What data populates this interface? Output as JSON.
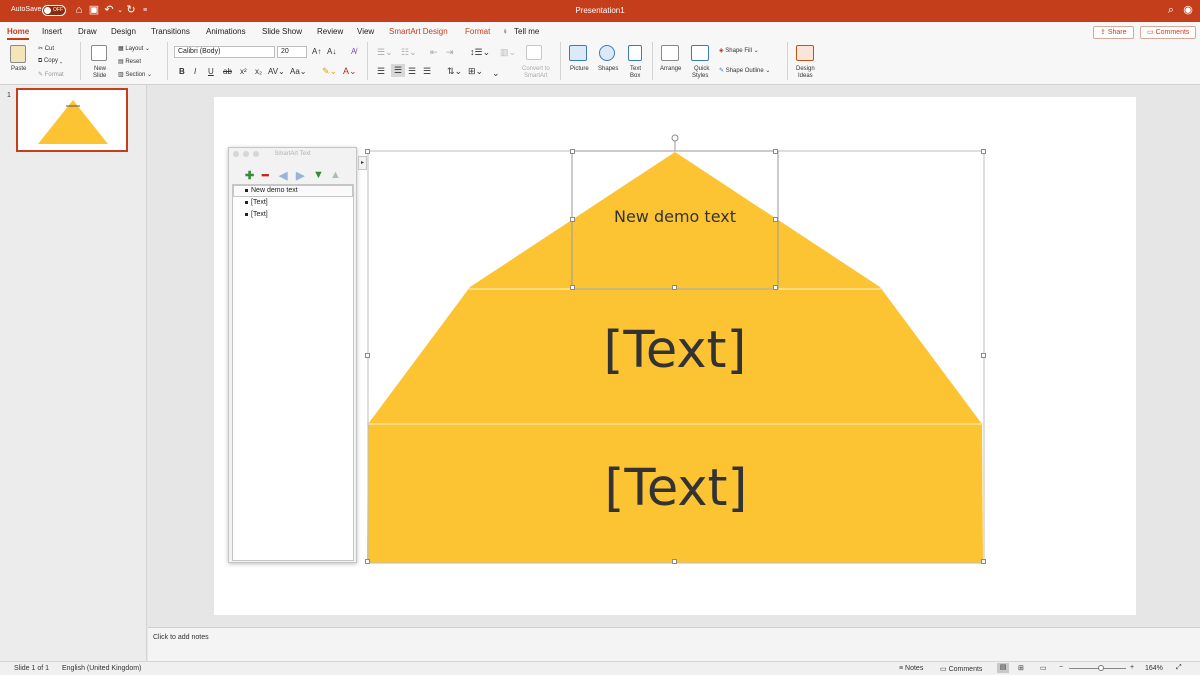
{
  "titlebar": {
    "autosave_label": "AutoSave",
    "toggle_state": "OFF",
    "title": "Presentation1",
    "color": "#c43e1c"
  },
  "tabs": [
    "Home",
    "Insert",
    "Draw",
    "Design",
    "Transitions",
    "Animations",
    "Slide Show",
    "Review",
    "View",
    "SmartArt Design",
    "Format"
  ],
  "tell_me": "Tell me",
  "share_label": "Share",
  "comments_label": "Comments",
  "clipboard": {
    "paste": "Paste",
    "cut": "Cut",
    "copy": "Copy",
    "format": "Format"
  },
  "slides_group": {
    "new_slide_1": "New",
    "new_slide_2": "Slide",
    "layout": "Layout",
    "reset": "Reset",
    "section": "Section"
  },
  "font": {
    "name": "Calibri (Body)",
    "size": "20"
  },
  "insert_group": {
    "convert_1": "Convert to",
    "convert_2": "SmartArt",
    "picture": "Picture",
    "shapes": "Shapes",
    "textbox_1": "Text",
    "textbox_2": "Box",
    "arrange": "Arrange",
    "quick_1": "Quick",
    "quick_2": "Styles",
    "shape_fill": "Shape Fill",
    "shape_outline": "Shape Outline",
    "design_1": "Design",
    "design_2": "Ideas"
  },
  "thumbnail": {
    "number": "1"
  },
  "smartart_pane": {
    "title": "SmartArt Text",
    "items": [
      "New demo text",
      "[Text]",
      "[Text]"
    ]
  },
  "pyramid": {
    "fill": "#fcc433",
    "levels": [
      "New demo text",
      "[Text]",
      "[Text]"
    ]
  },
  "notes_placeholder": "Click to add notes",
  "status": {
    "slide": "Slide 1 of 1",
    "language": "English (United Kingdom)",
    "notes": "Notes",
    "comments": "Comments",
    "zoom": "164%"
  }
}
